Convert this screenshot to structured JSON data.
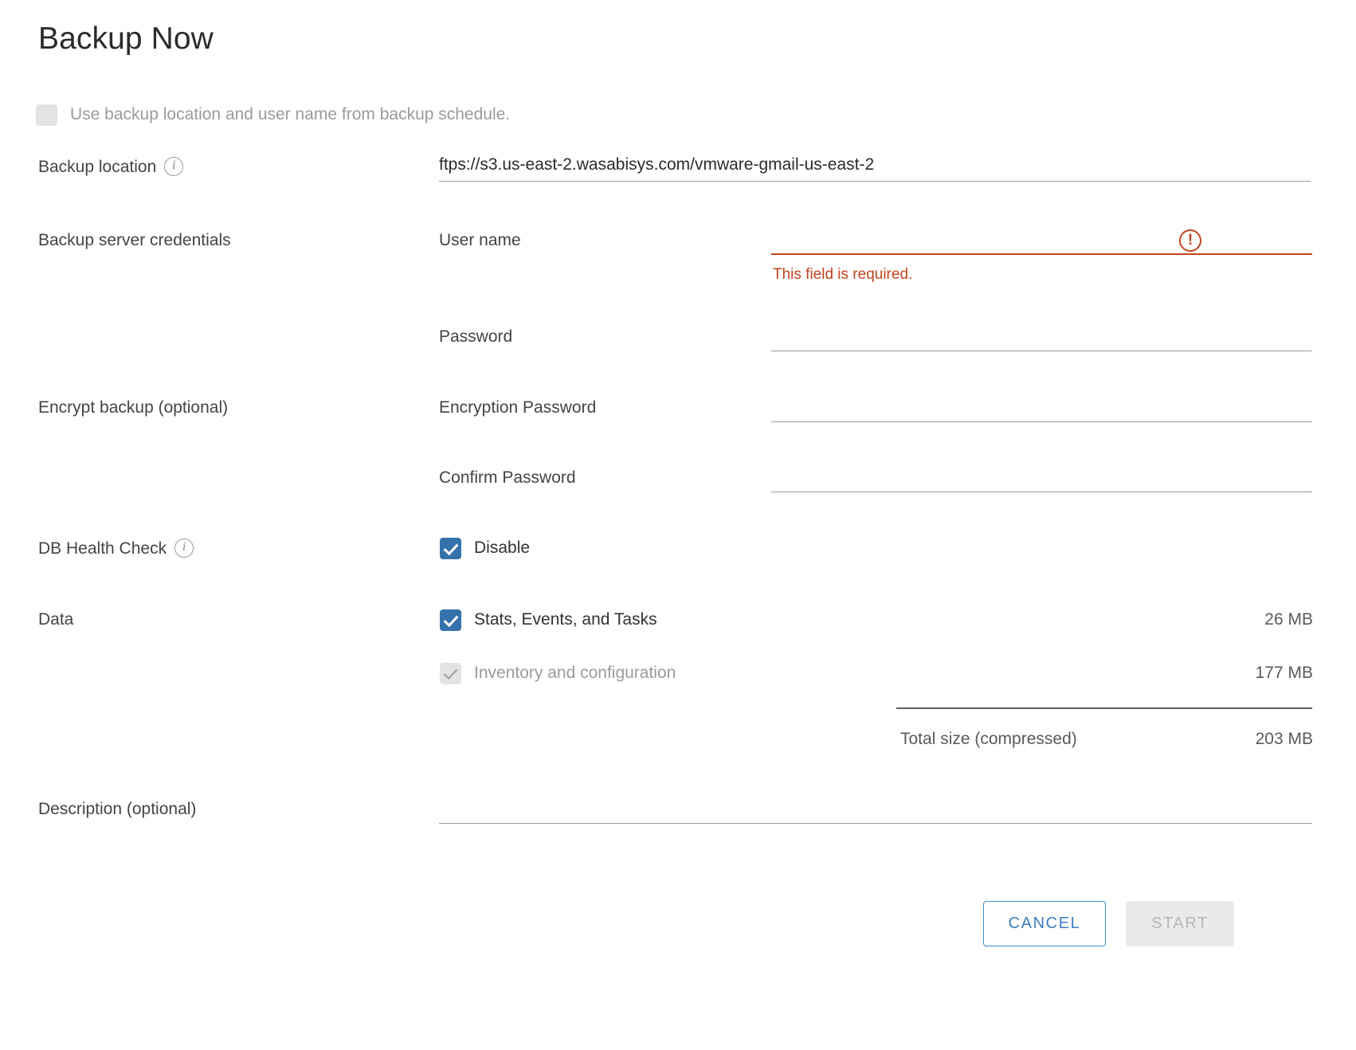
{
  "dialog": {
    "title": "Backup Now"
  },
  "use_schedule": {
    "label": "Use backup location and user name from backup schedule.",
    "checked": false,
    "disabled": true
  },
  "backup_location": {
    "label": "Backup location",
    "info_icon": "info-circle-icon",
    "value": "ftps://s3.us-east-2.wasabisys.com/vmware-gmail-us-east-2",
    "placeholder": ""
  },
  "credentials": {
    "section_label": "Backup server credentials",
    "user_name": {
      "label": "User name",
      "value": "",
      "placeholder": "",
      "error": "This field is required.",
      "error_icon": "exclamation-circle-icon",
      "has_error": true
    },
    "password": {
      "label": "Password",
      "value": "",
      "placeholder": ""
    }
  },
  "encrypt": {
    "section_label": "Encrypt backup (optional)",
    "encryption_password": {
      "label": "Encryption Password",
      "value": "",
      "placeholder": ""
    },
    "confirm_password": {
      "label": "Confirm Password",
      "value": "",
      "placeholder": ""
    }
  },
  "db_health_check": {
    "section_label": "DB Health Check",
    "info_icon": "info-circle-icon",
    "disable": {
      "label": "Disable",
      "checked": true
    }
  },
  "data": {
    "section_label": "Data",
    "items": [
      {
        "label": "Stats, Events, and Tasks",
        "size": "26 MB",
        "checked": true,
        "disabled": false
      },
      {
        "label": "Inventory and configuration",
        "size": "177 MB",
        "checked": true,
        "disabled": true
      }
    ],
    "total_label": "Total size (compressed)",
    "total_size": "203 MB"
  },
  "description": {
    "label": "Description (optional)",
    "value": "",
    "placeholder": ""
  },
  "footer": {
    "cancel_label": "CANCEL",
    "start_label": "START",
    "start_disabled": true
  },
  "colors": {
    "accent_blue": "#3572ab",
    "link_blue": "#3a7ebf",
    "error_red": "#c1441e",
    "text": "#313131",
    "muted": "#9b9b9b",
    "rule": "#9a9a9a"
  }
}
